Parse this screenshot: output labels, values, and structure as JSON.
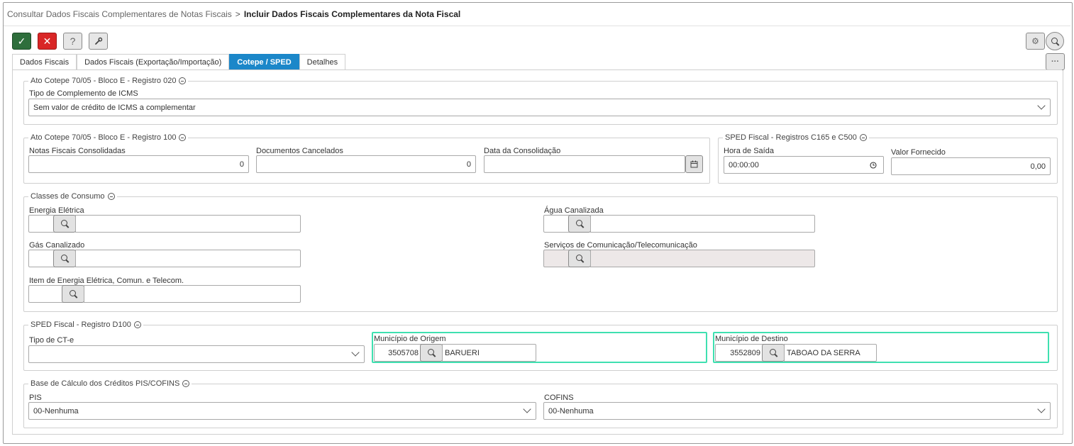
{
  "breadcrumb": {
    "parent": "Consultar Dados Fiscais Complementares de Notas Fiscais",
    "separator": ">",
    "current": "Incluir Dados Fiscais Complementares da Nota Fiscal"
  },
  "toolbar": {
    "confirm_icon": "✓",
    "cancel_icon": "✕",
    "help_icon": "?",
    "tools_icon": "wrench",
    "settings_icon": "⚙",
    "more_icon": "···"
  },
  "tabs": [
    {
      "label": "Dados Fiscais",
      "active": false
    },
    {
      "label": "Dados Fiscais (Exportação/Importação)",
      "active": false
    },
    {
      "label": "Cotepe / SPED",
      "active": true
    },
    {
      "label": "Detalhes",
      "active": false
    }
  ],
  "reg020": {
    "legend": "Ato Cotepe 70/05 - Bloco E - Registro 020",
    "tipo_label": "Tipo de Complemento de ICMS",
    "tipo_value": "Sem valor de crédito de ICMS a complementar"
  },
  "reg100": {
    "legend": "Ato Cotepe 70/05 - Bloco E - Registro 100",
    "nf_label": "Notas Fiscais Consolidadas",
    "nf_value": "0",
    "doc_label": "Documentos Cancelados",
    "doc_value": "0",
    "data_label": "Data da Consolidação",
    "data_value": ""
  },
  "c165": {
    "legend": "SPED Fiscal - Registros C165 e C500",
    "hora_label": "Hora de Saída",
    "hora_value": "00:00:00",
    "valor_label": "Valor Fornecido",
    "valor_value": "0,00"
  },
  "classes": {
    "legend": "Classes de Consumo",
    "energia_label": "Energia Elétrica",
    "agua_label": "Água Canalizada",
    "gas_label": "Gás Canalizado",
    "servicos_label": "Serviços de Comunicação/Telecomunicação",
    "item_label": "Item de Energia Elétrica, Comun. e Telecom."
  },
  "d100": {
    "legend": "SPED Fiscal - Registro D100",
    "tipo_label": "Tipo de CT-e",
    "tipo_value": "",
    "origem_label": "Município de Origem",
    "origem_code": "3505708",
    "origem_name": "BARUERI",
    "destino_label": "Município de Destino",
    "destino_code": "3552809",
    "destino_name": "TABOAO DA SERRA"
  },
  "piscofins": {
    "legend": "Base de Cálculo dos Créditos PIS/COFINS",
    "pis_label": "PIS",
    "pis_value": "00-Nenhuma",
    "cofins_label": "COFINS",
    "cofins_value": "00-Nenhuma"
  }
}
